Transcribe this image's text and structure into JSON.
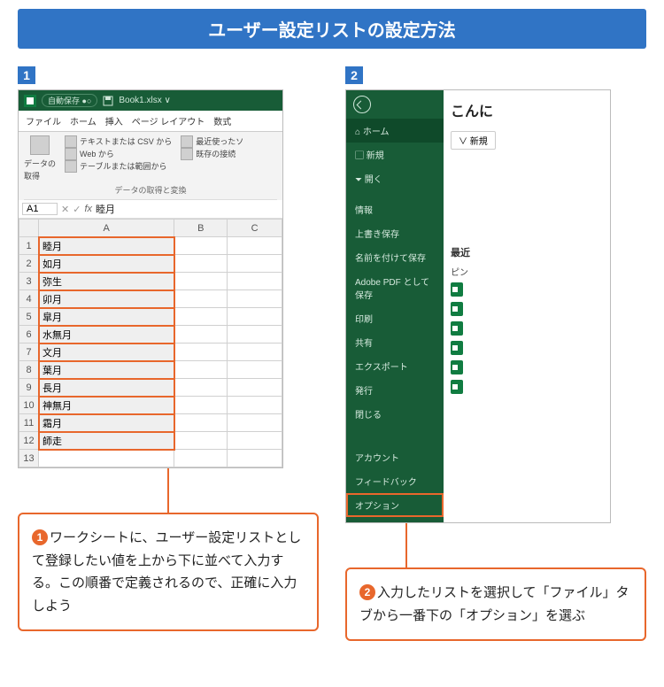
{
  "title": "ユーザー設定リストの設定方法",
  "panel1": {
    "badge": "1",
    "titlebar": {
      "autosave": "自動保存",
      "doc": "Book1.xlsx ∨"
    },
    "tabs": [
      "ファイル",
      "ホーム",
      "挿入",
      "ページ レイアウト",
      "数式"
    ],
    "ribbon": {
      "btn1": "テキストまたは CSV から",
      "btn2": "Web から",
      "btn3": "テーブルまたは範囲から",
      "btn4": "最近使ったソ",
      "btn5": "既存の接続",
      "bigbtn": "データの\n取得",
      "group": "データの取得と変換"
    },
    "namebox": "A1",
    "fvalue": "睦月",
    "cols": [
      "",
      "A",
      "B",
      "C"
    ],
    "rows": [
      {
        "n": "1",
        "a": "睦月"
      },
      {
        "n": "2",
        "a": "如月"
      },
      {
        "n": "3",
        "a": "弥生"
      },
      {
        "n": "4",
        "a": "卯月"
      },
      {
        "n": "5",
        "a": "皐月"
      },
      {
        "n": "6",
        "a": "水無月"
      },
      {
        "n": "7",
        "a": "文月"
      },
      {
        "n": "8",
        "a": "葉月"
      },
      {
        "n": "9",
        "a": "長月"
      },
      {
        "n": "10",
        "a": "神無月"
      },
      {
        "n": "11",
        "a": "霜月"
      },
      {
        "n": "12",
        "a": "師走"
      },
      {
        "n": "13",
        "a": ""
      }
    ],
    "callout_num": "1",
    "callout": "ワークシートに、ユーザー設定リストとして登録したい値を上から下に並べて入力する。この順番で定義されるので、正確に入力しよう"
  },
  "panel2": {
    "badge": "2",
    "heading": "こんに",
    "pill": "∨ 新規",
    "side": {
      "home": "ホーム",
      "new": "新規",
      "open": "開く",
      "info": "情報",
      "save": "上書き保存",
      "saveas": "名前を付けて保存",
      "pdf": "Adobe PDF として保存",
      "print": "印刷",
      "share": "共有",
      "export": "エクスポート",
      "publish": "発行",
      "close": "閉じる",
      "account": "アカウント",
      "feedback": "フィードバック",
      "options": "オプション"
    },
    "sec1": "最近",
    "pin": "ピン",
    "callout_num": "2",
    "callout": "入力したリストを選択して「ファイル」タブから一番下の「オプション」を選ぶ"
  }
}
